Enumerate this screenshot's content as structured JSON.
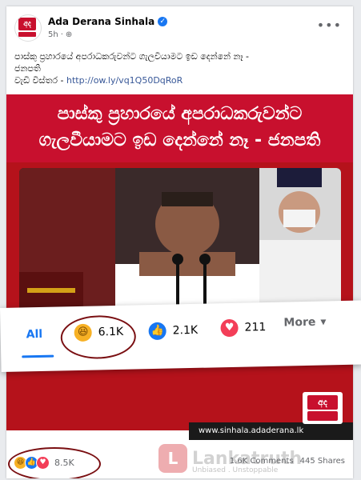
{
  "post": {
    "page_name": "Ada Derana Sinhala",
    "time": "5h",
    "privacy_icon": "globe-icon",
    "verified_icon": "verified-badge-icon",
    "more_icon": "ellipsis-icon",
    "text_line1": "පාස්කු ප්‍රහාරයේ අපරාධකරුවන්ට ගැලවීයාමට ඉඩ දෙන්නේ නෑ -",
    "text_line2": "ජනපති",
    "text_more_label": "වැඩි විස්තර -",
    "text_link": "http://ow.ly/vq1Q50DqRoR",
    "avatar_logo_text": "අද"
  },
  "image": {
    "headline_line1": "පාස්කු ප්‍රහාරයේ අපරාධකරුවන්ට",
    "headline_line2": "ගැලවීයාමට ඉඩ දෙන්නේ නෑ - ජනපති",
    "url_bar": "www.sinhala.adaderana.lk",
    "logo_text": "අද"
  },
  "reactions_popup": {
    "all_label": "All",
    "haha_count": "6.1K",
    "like_count": "2.1K",
    "love_count": "211",
    "more_label": "More"
  },
  "footer": {
    "reactions_total": "8.5K",
    "comments": "1.6K Comments",
    "shares": "445 Shares",
    "watermark_name": "Lankatruth",
    "watermark_tagline": "Unbiased . Unstoppable"
  }
}
